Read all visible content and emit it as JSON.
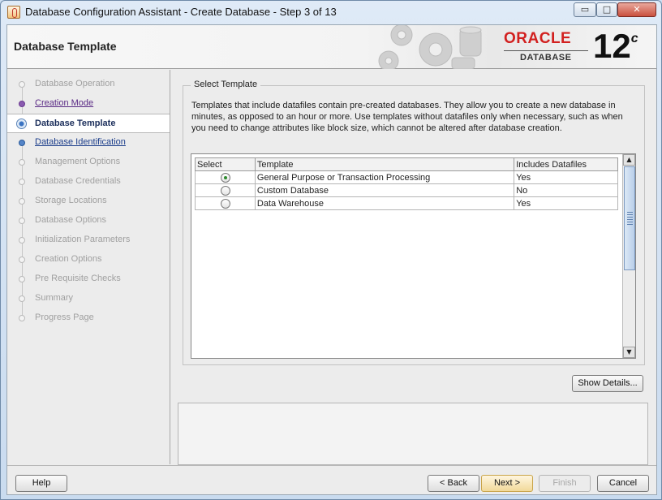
{
  "window": {
    "title": "Database Configuration Assistant - Create Database - Step 3 of 13",
    "buttons": {
      "minimize": "▭",
      "maximize": "□",
      "close": "✕"
    }
  },
  "header": {
    "title": "Database Template",
    "logo": {
      "brand": "ORACLE",
      "product": "DATABASE",
      "version": "12",
      "version_suffix": "c",
      "brand_color": "#d2201f"
    }
  },
  "sidebar": {
    "steps": [
      {
        "label": "Database Operation",
        "state": "done"
      },
      {
        "label": "Creation Mode",
        "state": "link"
      },
      {
        "label": "Database Template",
        "state": "active"
      },
      {
        "label": "Database Identification",
        "state": "link"
      },
      {
        "label": "Management Options",
        "state": "disabled"
      },
      {
        "label": "Database Credentials",
        "state": "disabled"
      },
      {
        "label": "Storage Locations",
        "state": "disabled"
      },
      {
        "label": "Database Options",
        "state": "disabled"
      },
      {
        "label": "Initialization Parameters",
        "state": "disabled"
      },
      {
        "label": "Creation Options",
        "state": "disabled"
      },
      {
        "label": "Pre Requisite Checks",
        "state": "disabled"
      },
      {
        "label": "Summary",
        "state": "disabled"
      },
      {
        "label": "Progress Page",
        "state": "disabled"
      }
    ]
  },
  "main": {
    "group_title": "Select Template",
    "description": "Templates that include datafiles contain pre-created databases. They allow you to create a new database in minutes, as opposed to an hour or more. Use templates without datafiles only when necessary, such as when you need to change attributes like block size, which cannot be altered after database creation.",
    "table": {
      "headers": [
        "Select",
        "Template",
        "Includes Datafiles"
      ],
      "rows": [
        {
          "selected": true,
          "template": "General Purpose or Transaction Processing",
          "datafiles": "Yes"
        },
        {
          "selected": false,
          "template": "Custom Database",
          "datafiles": "No"
        },
        {
          "selected": false,
          "template": "Data Warehouse",
          "datafiles": "Yes"
        }
      ]
    },
    "show_details_label": "Show Details..."
  },
  "footer": {
    "help": "Help",
    "back": "< Back",
    "next": "Next >",
    "finish": "Finish",
    "cancel": "Cancel"
  }
}
